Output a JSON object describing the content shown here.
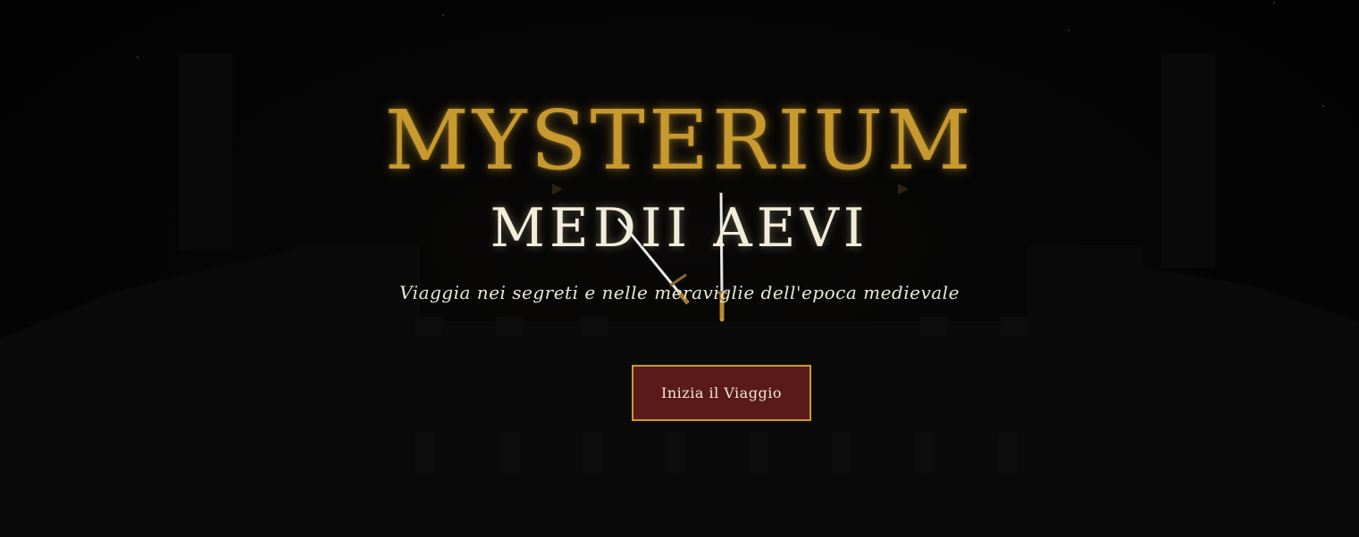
{
  "hero": {
    "title": "MYSTERIUM",
    "subtitle": "MEDII AEVI",
    "tagline": "Viaggia nei segreti e nelle meraviglie dell'epoca medievale",
    "cta_label": "Inizia il Viaggio",
    "decoration_icon": "crossed-swords-icon"
  },
  "colors": {
    "background": "#020202",
    "title_gold": "#c8992f",
    "subtitle_ivory": "#f3ecd9",
    "button_fill": "#5a1a1a",
    "button_border": "#c8992f",
    "castle_silhouette": "#0b0b0b"
  }
}
